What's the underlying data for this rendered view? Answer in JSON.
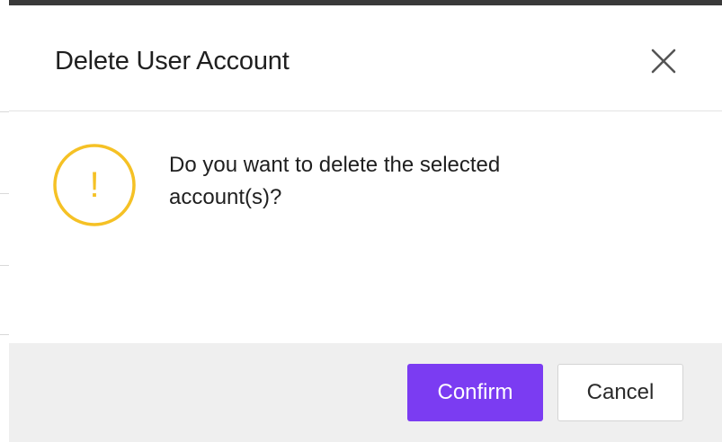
{
  "dialog": {
    "title": "Delete User Account",
    "close_icon": "close-icon",
    "warning_icon": "warning-icon",
    "warning_glyph": "!",
    "message": "Do you want to delete the selected account(s)?",
    "confirm_label": "Confirm",
    "cancel_label": "Cancel"
  },
  "colors": {
    "accent": "#7b3cf2",
    "warning": "#f5c125",
    "footer_bg": "#efefef"
  }
}
